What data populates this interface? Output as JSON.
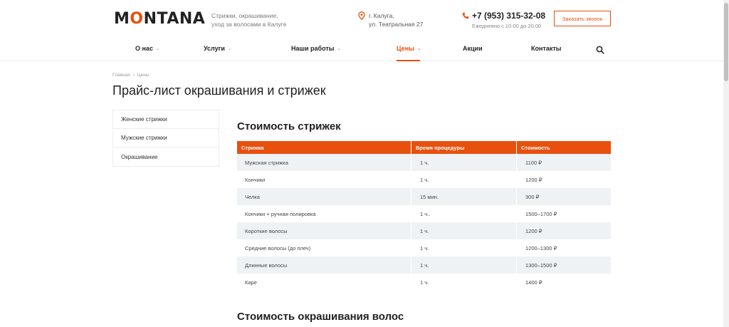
{
  "header": {
    "logo": {
      "part1": "M",
      "accent": "O",
      "part2": "NTANA"
    },
    "tagline": {
      "line1": "Стрижки, окрашивание,",
      "line2": "уход за волосами в Калуге"
    },
    "address": {
      "line1": "г. Калуга,",
      "line2": "ул. Театральная 27"
    },
    "phone": {
      "number": "+7 (953) 315-32-08",
      "hours": "Ежедневно с 10:00 до 20:00"
    },
    "call_button": "Заказать звонок"
  },
  "nav": {
    "items": [
      {
        "label": "О нас",
        "has_dropdown": true,
        "active": false
      },
      {
        "label": "Услуги",
        "has_dropdown": true,
        "active": false
      },
      {
        "label": "Наши работы",
        "has_dropdown": true,
        "active": false
      },
      {
        "label": "Цены",
        "has_dropdown": true,
        "active": true
      },
      {
        "label": "Акции",
        "has_dropdown": false,
        "active": false
      },
      {
        "label": "Контакты",
        "has_dropdown": false,
        "active": false
      }
    ],
    "dropdown_glyph": "⌄"
  },
  "breadcrumb": {
    "home": "Главная",
    "separator": "›",
    "current": "Цены"
  },
  "page_title": "Прайс-лист окрашивания и стрижек",
  "sidebar": {
    "items": [
      "Женские стрижки",
      "Мужские стрижки",
      "Окрашивание"
    ]
  },
  "haircuts": {
    "title": "Стоимость стрижек",
    "headers": [
      "Стрижка",
      "Время процедуры",
      "Стоимость"
    ],
    "rows": [
      [
        "Мужская стрижка",
        "1 ч.",
        "1100 ₽"
      ],
      [
        "Кончики",
        "1 ч.",
        "1200 ₽"
      ],
      [
        "Челка",
        "15 мин.",
        "300 ₽"
      ],
      [
        "Кончики + ручная полировка",
        "1 ч..",
        "1500–1700 ₽"
      ],
      [
        "Короткие волосы",
        "1 ч.",
        "1200 ₽"
      ],
      [
        "Средние волосы (до плеч)",
        "1 ч.",
        "1200–1300 ₽"
      ],
      [
        "Длинные волосы",
        "1 ч.",
        "1300–1500 ₽"
      ],
      [
        "Каре",
        "1 ч.",
        "1400 ₽"
      ]
    ]
  },
  "coloring": {
    "title": "Стоимость окрашивания волос"
  },
  "colors": {
    "accent": "#e8500e",
    "row_alt": "#eff2f4",
    "text": "#222222"
  }
}
